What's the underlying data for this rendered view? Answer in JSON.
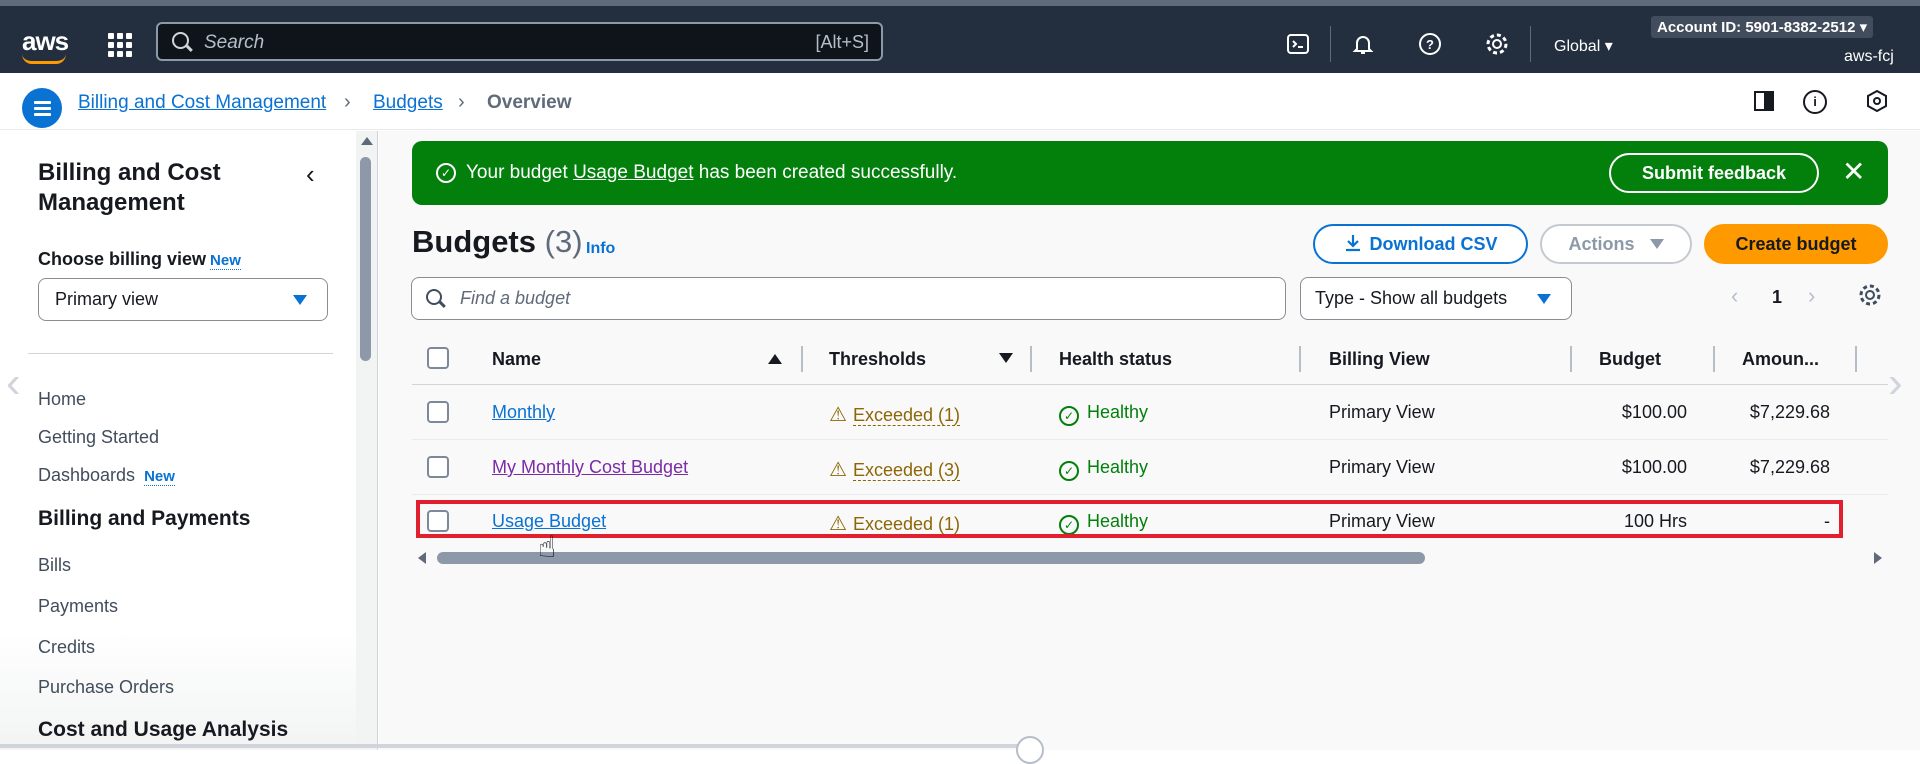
{
  "topbar": {
    "logo": "aws",
    "search_placeholder": "Search",
    "search_shortcut": "[Alt+S]",
    "region": "Global ▾",
    "account": "Account ID: 5901-8382-2512 ▾",
    "user": "aws-fcj",
    "icons": [
      "cloudshell-icon",
      "bell-icon",
      "help-icon",
      "gear-icon"
    ]
  },
  "breadcrumb": {
    "items": [
      "Billing and Cost Management",
      "Budgets",
      "Overview"
    ]
  },
  "sidebar": {
    "title": "Billing and Cost Management",
    "choose_label": "Choose billing view",
    "new_badge": "New",
    "selected_view": "Primary view",
    "items": [
      "Home",
      "Getting Started",
      "Dashboards"
    ],
    "dashboards_badge": "New",
    "section_billing": "Billing and Payments",
    "billing_items": [
      "Bills",
      "Payments",
      "Credits",
      "Purchase Orders"
    ],
    "section_cost": "Cost and Usage Analysis"
  },
  "flash": {
    "prefix": "Your budget ",
    "budget_link": "Usage Budget",
    "suffix": " has been created successfully.",
    "feedback": "Submit feedback"
  },
  "page": {
    "title": "Budgets",
    "count": "(3)",
    "info": "Info",
    "download_csv": "Download CSV",
    "actions": "Actions",
    "create": "Create budget",
    "find_placeholder": "Find a budget",
    "type_filter": "Type - Show all budgets",
    "page_number": "1"
  },
  "table": {
    "headers": [
      "Name",
      "Thresholds",
      "Health status",
      "Billing View",
      "Budget",
      "Amoun..."
    ],
    "rows": [
      {
        "name": "Monthly",
        "threshold": "Exceeded (1)",
        "health": "Healthy",
        "view": "Primary View",
        "budget": "$100.00",
        "amount": "$7,229.68"
      },
      {
        "name": "My Monthly Cost Budget",
        "threshold": "Exceeded (3)",
        "health": "Healthy",
        "view": "Primary View",
        "budget": "$100.00",
        "amount": "$7,229.68"
      },
      {
        "name": "Usage Budget",
        "threshold": "Exceeded (1)",
        "health": "Healthy",
        "view": "Primary View",
        "budget": "100 Hrs",
        "amount": "-"
      }
    ]
  },
  "colors": {
    "aws_dark": "#232f3e",
    "link_blue": "#0972d3",
    "success_green": "#037f0c",
    "warning": "#8d6605",
    "primary_orange": "#ff9900",
    "highlight_red": "#e0202e"
  }
}
